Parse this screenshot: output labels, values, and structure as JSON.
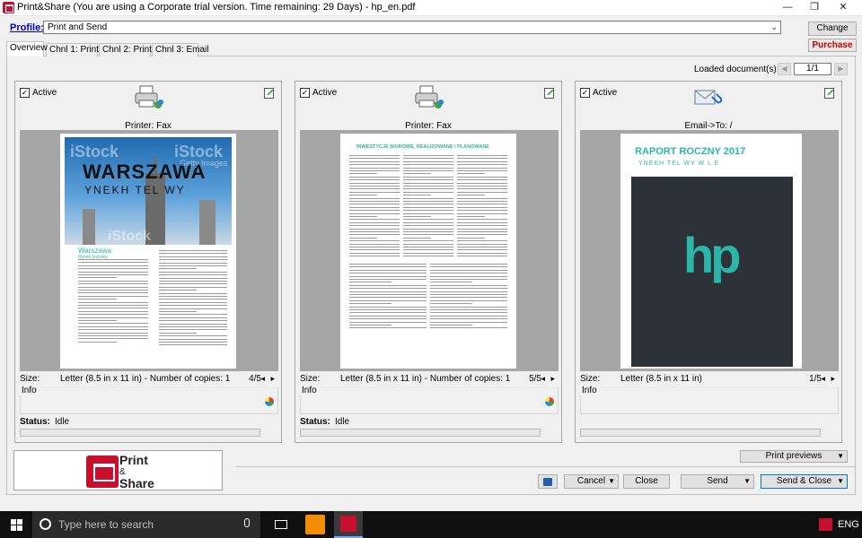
{
  "window": {
    "title": "Print&Share (You are using a Corporate trial version. Time remaining: 29 Days) - hp_en.pdf",
    "minimize": "—",
    "maximize": "❐",
    "close": "✕"
  },
  "profile": {
    "label": "Profile:",
    "value": "Print and Send",
    "change_label": "Change",
    "purchase_label": "Purchase"
  },
  "tabs": [
    {
      "label": "Overview",
      "active": true
    },
    {
      "label": "Chnl 1: Printer"
    },
    {
      "label": "Chnl 2: Printer"
    },
    {
      "label": "Chnl 3: Email"
    }
  ],
  "loaded": {
    "label": "Loaded document(s):",
    "counter": "1/1",
    "prev": "◀",
    "next": "▶"
  },
  "panels": [
    {
      "active_label": "Active",
      "checked": true,
      "target": "Printer: Fax",
      "icon": "printer-icon",
      "size_label": "Size:",
      "size_value": "Letter (8.5 in x 11 in) - Number of copies: 1",
      "page_count": "4/5",
      "arrows": "◂ ▸",
      "info_label": "Info",
      "status_label": "Status:",
      "status_value": "Idle",
      "preview": {
        "kind": "magazine",
        "headline": "WARSZAWA",
        "subhead": "YNEKH TEL WY",
        "watermark": "iStock",
        "watermark2": "Getty Images",
        "caption": "Warszawa",
        "caption_sub": "Rynek biurowy"
      }
    },
    {
      "active_label": "Active",
      "checked": true,
      "target": "Printer: Fax",
      "icon": "printer-icon",
      "size_label": "Size:",
      "size_value": "Letter (8.5 in x 11 in) - Number of copies: 1",
      "page_count": "5/5",
      "arrows": "◂ ▸",
      "info_label": "Info",
      "status_label": "Status:",
      "status_value": "Idle",
      "preview": {
        "kind": "text",
        "headline": "INWESTYCJE BIUROWE, REALIZOWANE I PLANOWANE"
      }
    },
    {
      "active_label": "Active",
      "checked": true,
      "target": "Email->To: /",
      "icon": "email-icon",
      "size_label": "Size:",
      "size_value": "Letter (8.5 in x 11 in)",
      "page_count": "1/5",
      "arrows": "◂ ▸",
      "info_label": "Info",
      "status_label": "",
      "status_value": "",
      "preview": {
        "kind": "cover",
        "headline": "RAPORT ROCZNY 2017",
        "subhead": "YNEKH TEL WY W  L  E",
        "logo": "hp"
      }
    }
  ],
  "bottom": {
    "logo_line1": "Print",
    "logo_line2": "&",
    "logo_line3": "Share",
    "print_previews": "Print previews",
    "cancel": "Cancel",
    "close": "Close",
    "send": "Send",
    "send_close": "Send & Close",
    "dropdown_arrow": "▼"
  },
  "taskbar": {
    "search_placeholder": "Type here to search",
    "lang": "ENG"
  },
  "colors": {
    "brand_red": "#c8102e",
    "purchase_red": "#d40000",
    "link_blue": "#0000cc",
    "teal": "#2ab7a9"
  }
}
